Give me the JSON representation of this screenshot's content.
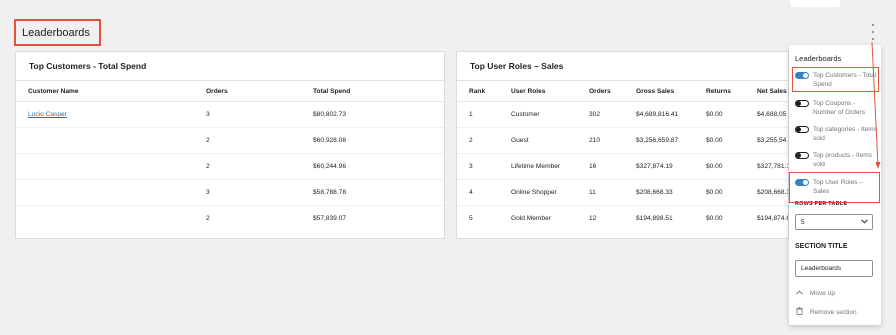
{
  "section": {
    "title": "Leaderboards"
  },
  "customers": {
    "title": "Top Customers - Total Spend",
    "columns": [
      "Customer Name",
      "Orders",
      "Total Spend"
    ],
    "rows": [
      {
        "name": "Lucio Casper",
        "orders": "3",
        "spend": "$80,802.73"
      },
      {
        "name": "",
        "orders": "2",
        "spend": "$60,928.08"
      },
      {
        "name": "",
        "orders": "2",
        "spend": "$60,244.96"
      },
      {
        "name": "",
        "orders": "3",
        "spend": "$58,788.78"
      },
      {
        "name": "",
        "orders": "2",
        "spend": "$57,839.07"
      }
    ]
  },
  "roles": {
    "title": "Top User Roles – Sales",
    "columns": [
      "Rank",
      "User Roles",
      "Orders",
      "Gross Sales",
      "Returns",
      "Net Sales"
    ],
    "rows": [
      {
        "rank": "1",
        "role": "Customer",
        "orders": "302",
        "gross": "$4,689,816.41",
        "returns": "$0.00",
        "net": "$4,688,05"
      },
      {
        "rank": "2",
        "role": "Guest",
        "orders": "210",
        "gross": "$3,256,659.87",
        "returns": "$0.00",
        "net": "$3,255,54"
      },
      {
        "rank": "3",
        "role": "Lifetime Member",
        "orders": "16",
        "gross": "$327,874.19",
        "returns": "$0.00",
        "net": "$327,781.1"
      },
      {
        "rank": "4",
        "role": "Online Shopper",
        "orders": "11",
        "gross": "$208,668.33",
        "returns": "$0.00",
        "net": "$208,668.3"
      },
      {
        "rank": "5",
        "role": "Gold Member",
        "orders": "12",
        "gross": "$194,898.51",
        "returns": "$0.00",
        "net": "$194,874.6"
      }
    ]
  },
  "popover": {
    "title": "Leaderboards",
    "toggles": [
      {
        "label": "Top Customers - Total Spend",
        "on": true
      },
      {
        "label": "Top Coupons - Number of Orders",
        "on": false
      },
      {
        "label": "Top categories - Items sold",
        "on": false
      },
      {
        "label": "Top products - Items sold",
        "on": false
      },
      {
        "label": "Top User Roles – Sales",
        "on": true
      }
    ],
    "rows_label": "ROWS PER TABLE",
    "rows_value": "5",
    "section_title_label": "SECTION TITLE",
    "section_title_value": "Leaderboards",
    "move_up": "Move up",
    "remove": "Remove section"
  },
  "colors": {
    "accent": "#3582c4",
    "highlight": "#e0533f",
    "link": "#2271b1"
  },
  "icons": {
    "menu": "kebab-menu-icon",
    "move_up": "chevron-up-icon",
    "remove": "trash-icon",
    "select": "chevron-down-icon"
  }
}
